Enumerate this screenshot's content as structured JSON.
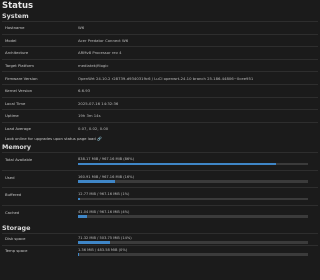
{
  "page": {
    "title": "Status"
  },
  "system": {
    "title": "System",
    "rows": [
      {
        "label": "Hostname",
        "value": "W6"
      },
      {
        "label": "Model",
        "value": "Acer Predator Connect W6"
      },
      {
        "label": "Architecture",
        "value": "ARMv8 Processor rev 4"
      },
      {
        "label": "Target Platform",
        "value": "mediatek/filogic"
      },
      {
        "label": "Firmware Version",
        "value": "OpenWrt 24.10.2 r28739-d9340319c6 / LuCI openwrt-24.10 branch 25.186.44806~0cee951"
      },
      {
        "label": "Kernel Version",
        "value": "6.6.93"
      },
      {
        "label": "Local Time",
        "value": "2025-07-16 14:32:36"
      },
      {
        "label": "Uptime",
        "value": "19h 3m 14s"
      },
      {
        "label": "Load Average",
        "value": "0.07, 0.02, 0.00"
      }
    ]
  },
  "online_check": {
    "text": "Look online for upgrades upon status page load",
    "icon": "link-icon"
  },
  "memory": {
    "title": "Memory",
    "rows": [
      {
        "label": "Total Available",
        "text": "838.17 MiB / 967.16 MiB (86%)",
        "fraction": 0.86
      },
      {
        "label": "Used",
        "text": "160.91 MiB / 967.16 MiB (16%)",
        "fraction": 0.16
      },
      {
        "label": "Buffered",
        "text": "12.77 MiB / 967.16 MiB (1%)",
        "fraction": 0.01
      },
      {
        "label": "Cached",
        "text": "41.04 MiB / 967.16 MiB (4%)",
        "fraction": 0.04
      }
    ]
  },
  "storage": {
    "title": "Storage",
    "rows": [
      {
        "label": "Disk space",
        "text": "71.32 MiB / 503.75 MiB (14%)",
        "fraction": 0.14
      },
      {
        "label": "Temp space",
        "text": "1.36 MiB / 483.58 MiB (0%)",
        "fraction": 0.003
      }
    ]
  },
  "colors": {
    "bar_fill": "#3f86c7",
    "bar_track": "#3b3b3b",
    "background": "#1b1b1b"
  }
}
